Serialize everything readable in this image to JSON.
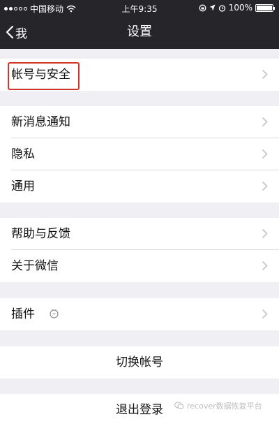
{
  "status_bar": {
    "carrier": "中国移动",
    "time": "上午9:35",
    "battery": "100%",
    "battery_level": 1.0
  },
  "nav": {
    "back_label": "我",
    "title": "设置"
  },
  "sections": {
    "account": {
      "label": "帐号与安全"
    },
    "notifications": {
      "label": "新消息通知"
    },
    "privacy": {
      "label": "隐私"
    },
    "general": {
      "label": "通用"
    },
    "help": {
      "label": "帮助与反馈"
    },
    "about": {
      "label": "关于微信"
    },
    "plugins": {
      "label": "插件"
    },
    "switch_account": {
      "label": "切换帐号"
    },
    "logout": {
      "label": "退出登录"
    }
  },
  "watermark": "recover数据恢复平台",
  "colors": {
    "nav_background": "#25252a",
    "page_background": "#efeff4",
    "highlight_border": "#d0352c"
  }
}
